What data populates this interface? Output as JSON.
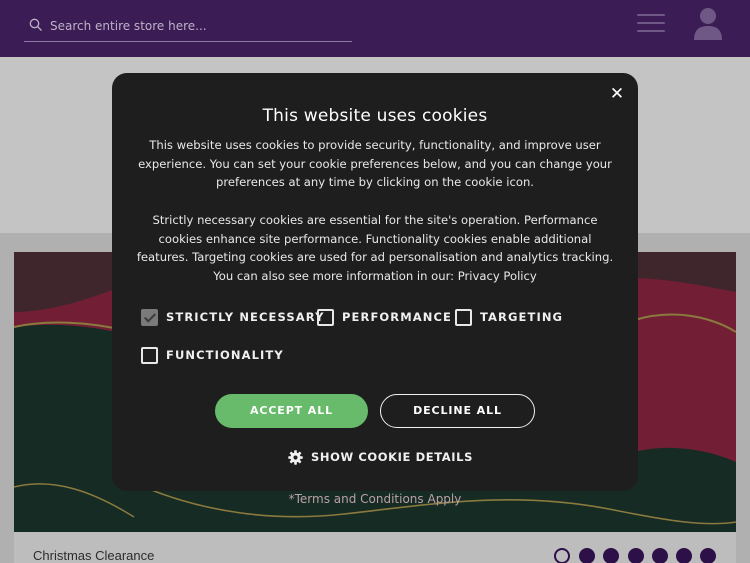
{
  "header": {
    "search_placeholder": "Search entire store here...",
    "search_icon": "search-icon",
    "menu_icon": "hamburger-menu-icon",
    "account_icon": "user-account-icon",
    "background_color": "#3c1c55"
  },
  "banner": {
    "terms_text": "*Terms and Conditions Apply",
    "background_color": "#721f35"
  },
  "product_row": {
    "title": "Christmas Clearance",
    "carousel_dots_total": 7,
    "carousel_dot_active_index": 0
  },
  "cookie_modal": {
    "title": "This website uses cookies",
    "paragraph1": "This website uses cookies to provide security, functionality, and improve user experience. You can set your cookie preferences below, and you can change your preferences at any time by clicking on the cookie icon.",
    "paragraph2_text": "Strictly necessary cookies are essential for the site's operation. Performance cookies enhance site performance. Functionality cookies enable additional features. Targeting cookies are used for ad personalisation and analytics tracking. You can also see more information in our: ",
    "privacy_link": "Privacy Policy",
    "close_label": "✕",
    "checkboxes": [
      {
        "label": "STRICTLY NECESSARY",
        "checked": true,
        "disabled": true
      },
      {
        "label": "PERFORMANCE",
        "checked": false
      },
      {
        "label": "TARGETING",
        "checked": false
      },
      {
        "label": "FUNCTIONALITY",
        "checked": false
      }
    ],
    "accept_label": "ACCEPT ALL",
    "decline_label": "DECLINE ALL",
    "details_label": "SHOW COOKIE DETAILS",
    "details_icon": "gear-icon",
    "accept_color": "#67bb6a",
    "modal_color": "#1e1e1e"
  }
}
